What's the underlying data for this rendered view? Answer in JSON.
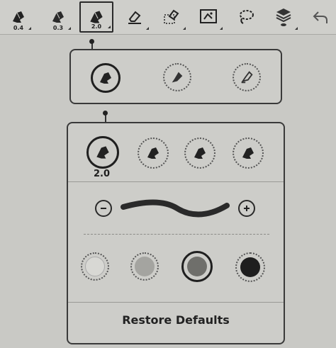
{
  "toolbar": {
    "tools": [
      {
        "name": "pen-tool",
        "size": "0.4"
      },
      {
        "name": "pen-tool",
        "size": "0.3"
      },
      {
        "name": "pen-tool",
        "size": "2.0",
        "selected": true
      },
      {
        "name": "eraser-tool"
      },
      {
        "name": "area-eraser-tool"
      },
      {
        "name": "select-image-tool"
      },
      {
        "name": "lasso-tool"
      },
      {
        "name": "layers-tool"
      },
      {
        "name": "undo-tool"
      }
    ]
  },
  "pen_type_panel": {
    "options": [
      {
        "icon": "brush-pen-icon",
        "selected": true
      },
      {
        "icon": "marker-pen-icon",
        "selected": false
      },
      {
        "icon": "highlighter-pen-icon",
        "selected": false
      }
    ]
  },
  "pen_settings_panel": {
    "size_options": [
      {
        "icon": "brush-size-icon",
        "selected": true,
        "label": "2.0"
      },
      {
        "icon": "brush-size-icon",
        "selected": false
      },
      {
        "icon": "brush-size-icon",
        "selected": false
      },
      {
        "icon": "brush-size-icon",
        "selected": false
      }
    ],
    "colors": [
      {
        "hex": "#d8d8d4",
        "selected": false
      },
      {
        "hex": "#a4a4a0",
        "selected": false
      },
      {
        "hex": "#6f6f6b",
        "selected": true
      },
      {
        "hex": "#1e1e1e",
        "selected": false
      }
    ],
    "restore_label": "Restore Defaults"
  }
}
